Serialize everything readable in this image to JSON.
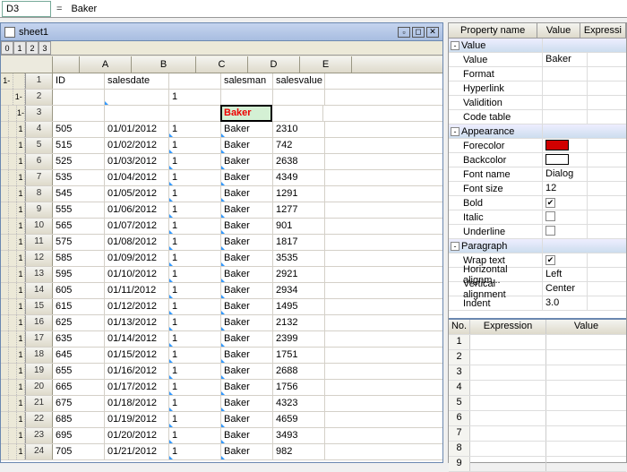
{
  "ref": {
    "cell": "D3",
    "eq": "=",
    "value": "Baker"
  },
  "sheet": {
    "title": "sheet1",
    "outline": [
      "0",
      "1",
      "2",
      "3"
    ]
  },
  "cols": [
    "A",
    "B",
    "C",
    "D",
    "E"
  ],
  "headers": {
    "A": "ID",
    "B": "salesdate",
    "C": "",
    "D": "salesman",
    "E": "salesvalue"
  },
  "row2c": "1",
  "selected": {
    "row": 3,
    "col": "D",
    "value": "Baker"
  },
  "rows": [
    {
      "n": 4,
      "A": "505",
      "B": "01/01/2012",
      "C": "1",
      "D": "Baker",
      "E": "2310"
    },
    {
      "n": 5,
      "A": "515",
      "B": "01/02/2012",
      "C": "1",
      "D": "Baker",
      "E": "742"
    },
    {
      "n": 6,
      "A": "525",
      "B": "01/03/2012",
      "C": "1",
      "D": "Baker",
      "E": "2638"
    },
    {
      "n": 7,
      "A": "535",
      "B": "01/04/2012",
      "C": "1",
      "D": "Baker",
      "E": "4349"
    },
    {
      "n": 8,
      "A": "545",
      "B": "01/05/2012",
      "C": "1",
      "D": "Baker",
      "E": "1291"
    },
    {
      "n": 9,
      "A": "555",
      "B": "01/06/2012",
      "C": "1",
      "D": "Baker",
      "E": "1277"
    },
    {
      "n": 10,
      "A": "565",
      "B": "01/07/2012",
      "C": "1",
      "D": "Baker",
      "E": "901"
    },
    {
      "n": 11,
      "A": "575",
      "B": "01/08/2012",
      "C": "1",
      "D": "Baker",
      "E": "1817"
    },
    {
      "n": 12,
      "A": "585",
      "B": "01/09/2012",
      "C": "1",
      "D": "Baker",
      "E": "3535"
    },
    {
      "n": 13,
      "A": "595",
      "B": "01/10/2012",
      "C": "1",
      "D": "Baker",
      "E": "2921"
    },
    {
      "n": 14,
      "A": "605",
      "B": "01/11/2012",
      "C": "1",
      "D": "Baker",
      "E": "2934"
    },
    {
      "n": 15,
      "A": "615",
      "B": "01/12/2012",
      "C": "1",
      "D": "Baker",
      "E": "1495"
    },
    {
      "n": 16,
      "A": "625",
      "B": "01/13/2012",
      "C": "1",
      "D": "Baker",
      "E": "2132"
    },
    {
      "n": 17,
      "A": "635",
      "B": "01/14/2012",
      "C": "1",
      "D": "Baker",
      "E": "2399"
    },
    {
      "n": 18,
      "A": "645",
      "B": "01/15/2012",
      "C": "1",
      "D": "Baker",
      "E": "1751"
    },
    {
      "n": 19,
      "A": "655",
      "B": "01/16/2012",
      "C": "1",
      "D": "Baker",
      "E": "2688"
    },
    {
      "n": 20,
      "A": "665",
      "B": "01/17/2012",
      "C": "1",
      "D": "Baker",
      "E": "1756"
    },
    {
      "n": 21,
      "A": "675",
      "B": "01/18/2012",
      "C": "1",
      "D": "Baker",
      "E": "4323"
    },
    {
      "n": 22,
      "A": "685",
      "B": "01/19/2012",
      "C": "1",
      "D": "Baker",
      "E": "4659"
    },
    {
      "n": 23,
      "A": "695",
      "B": "01/20/2012",
      "C": "1",
      "D": "Baker",
      "E": "3493"
    },
    {
      "n": 24,
      "A": "705",
      "B": "01/21/2012",
      "C": "1",
      "D": "Baker",
      "E": "982"
    }
  ],
  "prop_hdr": {
    "name": "Property name",
    "value": "Value",
    "expr": "Expressi"
  },
  "props": [
    {
      "t": "grp",
      "sym": "-",
      "label": "Value"
    },
    {
      "t": "prop",
      "label": "Value",
      "value": "Baker"
    },
    {
      "t": "prop",
      "label": "Format",
      "value": ""
    },
    {
      "t": "prop",
      "label": "Hyperlink",
      "value": ""
    },
    {
      "t": "prop",
      "label": "Validition",
      "value": ""
    },
    {
      "t": "prop",
      "label": "Code table",
      "value": ""
    },
    {
      "t": "grp",
      "sym": "-",
      "label": "Appearance"
    },
    {
      "t": "color",
      "label": "Forecolor",
      "color": "#d00000"
    },
    {
      "t": "color",
      "label": "Backcolor",
      "color": "#ffffff"
    },
    {
      "t": "prop",
      "label": "Font name",
      "value": "Dialog"
    },
    {
      "t": "prop",
      "label": "Font size",
      "value": "12"
    },
    {
      "t": "check",
      "label": "Bold",
      "checked": true
    },
    {
      "t": "check",
      "label": "Italic",
      "checked": false
    },
    {
      "t": "check",
      "label": "Underline",
      "checked": false
    },
    {
      "t": "grp",
      "sym": "-",
      "label": "Paragraph"
    },
    {
      "t": "check",
      "label": "Wrap text",
      "checked": true
    },
    {
      "t": "prop",
      "label": "Horizontal alignm...",
      "value": "Left"
    },
    {
      "t": "prop",
      "label": "Vertical alignment",
      "value": "Center"
    },
    {
      "t": "prop",
      "label": "Indent",
      "value": "3.0"
    }
  ],
  "expr_hdr": {
    "no": "No.",
    "expr": "Expression",
    "value": "Value"
  },
  "expr_rows": [
    "1",
    "2",
    "3",
    "4",
    "5",
    "6",
    "7",
    "8",
    "9"
  ]
}
